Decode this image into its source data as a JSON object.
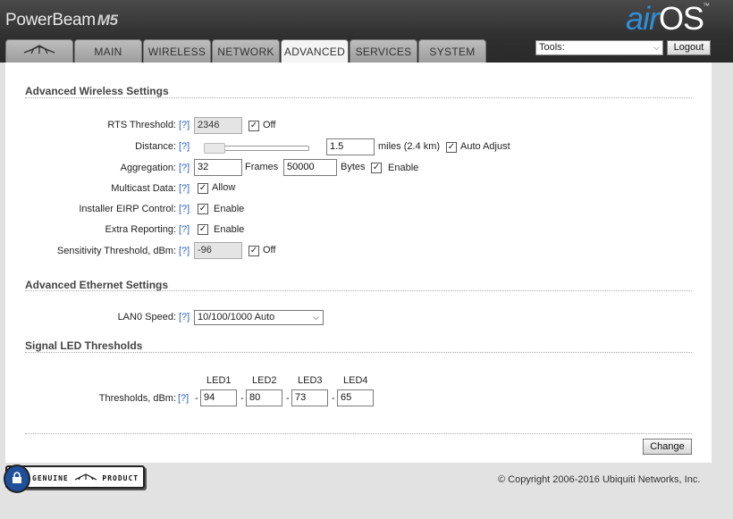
{
  "header": {
    "brand": "PowerBeam",
    "model": "M5",
    "logo_air": "air",
    "logo_os": "OS",
    "logo_tm": "™"
  },
  "tabs": [
    {
      "label": "",
      "icon": "ubiquiti-logo-icon"
    },
    {
      "label": "MAIN"
    },
    {
      "label": "WIRELESS"
    },
    {
      "label": "NETWORK"
    },
    {
      "label": "ADVANCED",
      "active": true
    },
    {
      "label": "SERVICES"
    },
    {
      "label": "SYSTEM"
    }
  ],
  "tools": {
    "selected": "Tools:"
  },
  "logout_label": "Logout",
  "wireless": {
    "title": "Advanced Wireless Settings",
    "rts_label": "RTS Threshold:",
    "rts_value": "2346",
    "rts_off_label": "Off",
    "distance_label": "Distance:",
    "distance_value": "1.5",
    "distance_unit": "miles (2.4 km)",
    "auto_adjust_label": "Auto Adjust",
    "aggregation_label": "Aggregation:",
    "aggregation_frames": "32",
    "frames_label": "Frames",
    "aggregation_bytes": "50000",
    "bytes_label": "Bytes",
    "aggregation_enable_label": "Enable",
    "multicast_label": "Multicast Data:",
    "multicast_allow_label": "Allow",
    "eirp_label": "Installer EIRP Control:",
    "eirp_enable_label": "Enable",
    "extra_label": "Extra Reporting:",
    "extra_enable_label": "Enable",
    "sensitivity_label": "Sensitivity Threshold, dBm:",
    "sensitivity_value": "-96",
    "sensitivity_off_label": "Off",
    "help": "[?]"
  },
  "ethernet": {
    "title": "Advanced Ethernet Settings",
    "lan0_label": "LAN0 Speed:",
    "lan0_value": "10/100/1000 Auto"
  },
  "led": {
    "title": "Signal LED Thresholds",
    "headers": [
      "LED1",
      "LED2",
      "LED3",
      "LED4"
    ],
    "label": "Thresholds, dBm:",
    "values": [
      "94",
      "80",
      "73",
      "65"
    ],
    "dash": "-"
  },
  "change_label": "Change",
  "badge": {
    "left": "GENUINE",
    "right": "PRODUCT"
  },
  "copyright": "© Copyright 2006-2016 Ubiquiti Networks, Inc.",
  "check_mark": "✓",
  "chevron": "⌵"
}
